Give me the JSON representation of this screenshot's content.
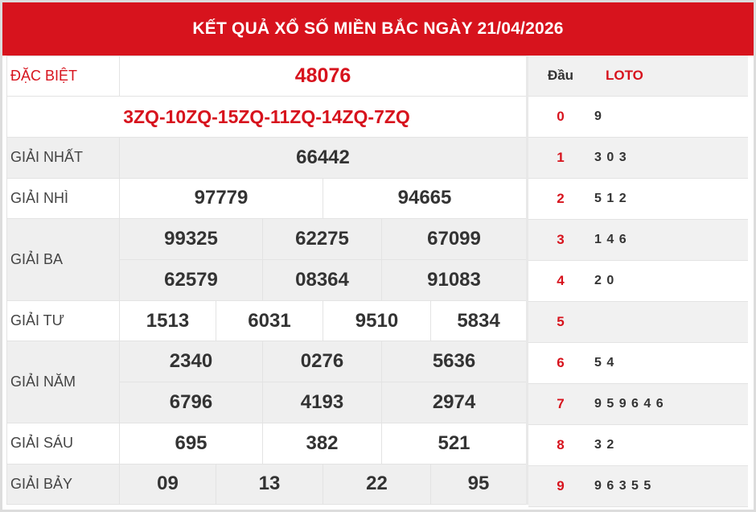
{
  "title": "KẾT QUẢ XỔ SỐ MIỀN BẮC NGÀY 21/04/2026",
  "prizes": {
    "special": {
      "label": "ĐẶC BIỆT",
      "value": "48076"
    },
    "codes": "3ZQ-10ZQ-15ZQ-11ZQ-14ZQ-7ZQ",
    "first": {
      "label": "GIẢI NHẤT",
      "values": [
        "66442"
      ]
    },
    "second": {
      "label": "GIẢI NHÌ",
      "values": [
        "97779",
        "94665"
      ]
    },
    "third": {
      "label": "GIẢI BA",
      "values": [
        "99325",
        "62275",
        "67099",
        "62579",
        "08364",
        "91083"
      ]
    },
    "fourth": {
      "label": "GIẢI TƯ",
      "values": [
        "1513",
        "6031",
        "9510",
        "5834"
      ]
    },
    "fifth": {
      "label": "GIẢI NĂM",
      "values": [
        "2340",
        "0276",
        "5636",
        "6796",
        "4193",
        "2974"
      ]
    },
    "sixth": {
      "label": "GIẢI SÁU",
      "values": [
        "695",
        "382",
        "521"
      ]
    },
    "seventh": {
      "label": "GIẢI BẢY",
      "values": [
        "09",
        "13",
        "22",
        "95"
      ]
    }
  },
  "loto": {
    "header_dau": "Đầu",
    "header_loto": "LOTO",
    "rows": [
      {
        "dau": "0",
        "loto": "9"
      },
      {
        "dau": "1",
        "loto": "3 0 3"
      },
      {
        "dau": "2",
        "loto": "5 1 2"
      },
      {
        "dau": "3",
        "loto": "1 4 6"
      },
      {
        "dau": "4",
        "loto": "2 0"
      },
      {
        "dau": "5",
        "loto": ""
      },
      {
        "dau": "6",
        "loto": "5 4"
      },
      {
        "dau": "7",
        "loto": "9 5 9 6 4 6"
      },
      {
        "dau": "8",
        "loto": "3 2"
      },
      {
        "dau": "9",
        "loto": "9 6 3 5 5"
      }
    ]
  },
  "colors": {
    "accent": "#d7131d",
    "text": "#333333",
    "row_alt": "#efefef"
  }
}
